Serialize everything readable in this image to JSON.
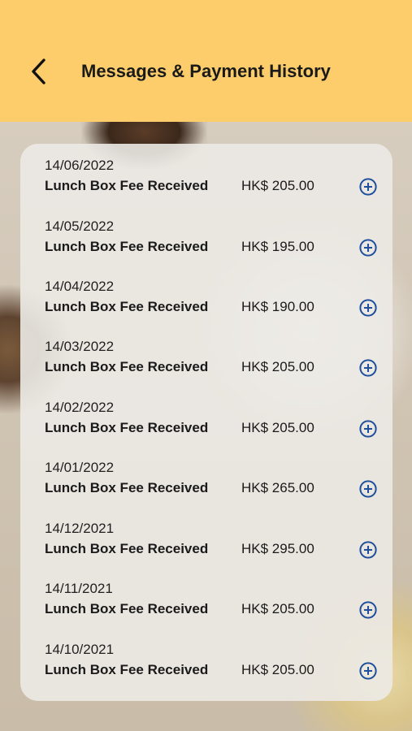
{
  "header": {
    "title": "Messages & Payment History",
    "back_icon": "chevron-left-icon",
    "background_color": "#fccd6a"
  },
  "history": {
    "expand_icon": "plus-circle-icon",
    "accent_color": "#1f4f9c",
    "items": [
      {
        "date": "14/06/2022",
        "description": "Lunch Box Fee Received",
        "amount": "HK$ 205.00"
      },
      {
        "date": "14/05/2022",
        "description": "Lunch Box Fee Received",
        "amount": "HK$ 195.00"
      },
      {
        "date": "14/04/2022",
        "description": "Lunch Box Fee Received",
        "amount": "HK$ 190.00"
      },
      {
        "date": "14/03/2022",
        "description": "Lunch Box Fee Received",
        "amount": "HK$ 205.00"
      },
      {
        "date": "14/02/2022",
        "description": "Lunch Box Fee Received",
        "amount": "HK$ 205.00"
      },
      {
        "date": "14/01/2022",
        "description": "Lunch Box Fee Received",
        "amount": "HK$ 265.00"
      },
      {
        "date": "14/12/2021",
        "description": "Lunch Box Fee Received",
        "amount": "HK$ 295.00"
      },
      {
        "date": "14/11/2021",
        "description": "Lunch Box Fee Received",
        "amount": "HK$ 205.00"
      },
      {
        "date": "14/10/2021",
        "description": "Lunch Box Fee Received",
        "amount": "HK$ 205.00"
      }
    ]
  }
}
